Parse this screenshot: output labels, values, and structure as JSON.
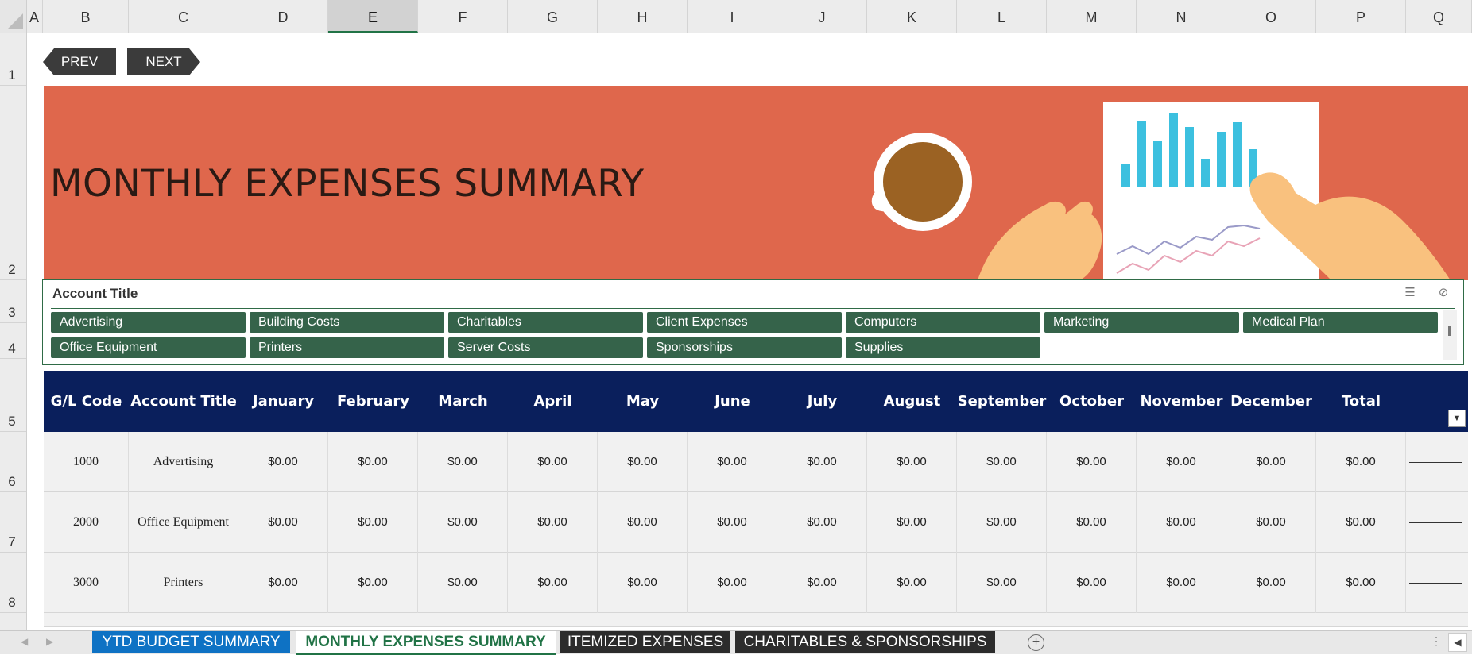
{
  "columns": [
    "A",
    "B",
    "C",
    "D",
    "E",
    "F",
    "G",
    "H",
    "I",
    "J",
    "K",
    "L",
    "M",
    "N",
    "O",
    "P",
    "Q"
  ],
  "active_column": "E",
  "rows": [
    "1",
    "2",
    "3",
    "4",
    "5",
    "6",
    "7",
    "8"
  ],
  "nav": {
    "prev": "PREV",
    "next": "NEXT"
  },
  "banner": {
    "title": "MONTHLY EXPENSES SUMMARY",
    "bg_color": "#df674c"
  },
  "slicer": {
    "title": "Account Title",
    "items": [
      "Advertising",
      "Building Costs",
      "Charitables",
      "Client Expenses",
      "Computers",
      "Marketing",
      "Medical Plan",
      "Office Equipment",
      "Printers",
      "Server Costs",
      "Sponsorships",
      "Supplies"
    ],
    "icons": [
      "multi-select-icon",
      "clear-filter-icon"
    ],
    "chip_color": "#35634a"
  },
  "table": {
    "headers": [
      "G/L Code",
      "Account Title",
      "January",
      "February",
      "March",
      "April",
      "May",
      "June",
      "July",
      "August",
      "September",
      "October",
      "November",
      "December",
      "Total"
    ],
    "header_color": "#0a1f5c",
    "rows": [
      {
        "code": "1000",
        "title": "Advertising",
        "values": [
          "$0.00",
          "$0.00",
          "$0.00",
          "$0.00",
          "$0.00",
          "$0.00",
          "$0.00",
          "$0.00",
          "$0.00",
          "$0.00",
          "$0.00",
          "$0.00",
          "$0.00"
        ]
      },
      {
        "code": "2000",
        "title": "Office Equipment",
        "values": [
          "$0.00",
          "$0.00",
          "$0.00",
          "$0.00",
          "$0.00",
          "$0.00",
          "$0.00",
          "$0.00",
          "$0.00",
          "$0.00",
          "$0.00",
          "$0.00",
          "$0.00"
        ]
      },
      {
        "code": "3000",
        "title": "Printers",
        "values": [
          "$0.00",
          "$0.00",
          "$0.00",
          "$0.00",
          "$0.00",
          "$0.00",
          "$0.00",
          "$0.00",
          "$0.00",
          "$0.00",
          "$0.00",
          "$0.00",
          "$0.00"
        ]
      }
    ]
  },
  "tabs": [
    {
      "label": "YTD BUDGET SUMMARY",
      "style": "ytd"
    },
    {
      "label": "MONTHLY EXPENSES SUMMARY",
      "style": "active"
    },
    {
      "label": "ITEMIZED EXPENSES",
      "style": "dark"
    },
    {
      "label": "CHARITABLES & SPONSORSHIPS",
      "style": "dark"
    }
  ]
}
